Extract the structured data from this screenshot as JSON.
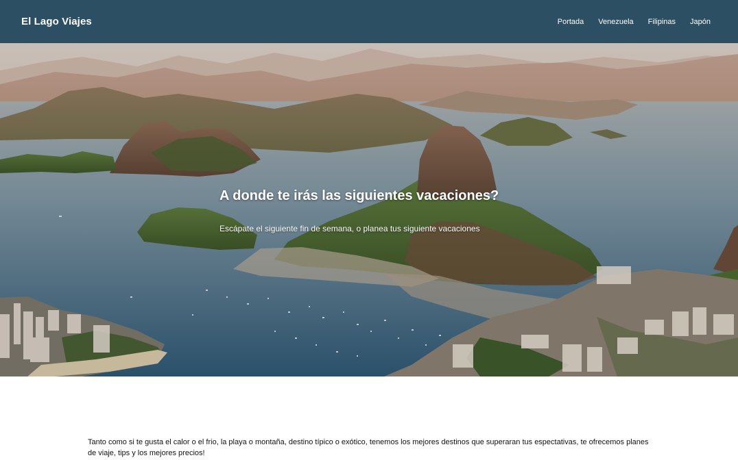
{
  "navbar": {
    "brand": "El Lago Viajes",
    "links": [
      "Portada",
      "Venezuela",
      "Filipinas",
      "Japón"
    ],
    "background_color": "#2c4f63"
  },
  "hero": {
    "title": "A donde te irás las siguientes vacaciones?",
    "subtitle": "Escápate el siguiente fin de semana, o planea tus siguiente vacaciones"
  },
  "intro": {
    "text": "Tanto como si te gusta el calor o el frio, la playa o montaña, destino típico o exótico, tenemos los mejores destinos que superaran tus espectativas, te ofrecemos planes de viaje, tips y los mejores precios!"
  }
}
